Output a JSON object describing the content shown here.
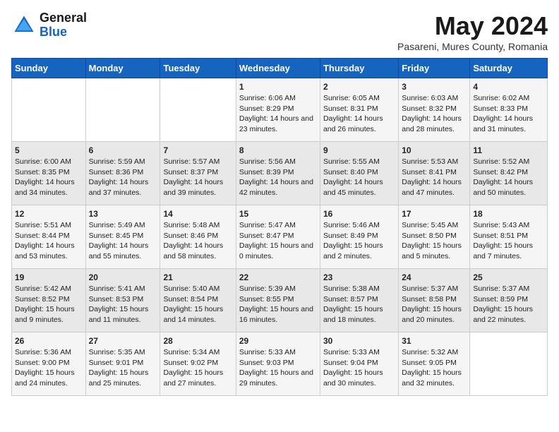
{
  "header": {
    "logo_general": "General",
    "logo_blue": "Blue",
    "month_title": "May 2024",
    "location": "Pasareni, Mures County, Romania"
  },
  "days_of_week": [
    "Sunday",
    "Monday",
    "Tuesday",
    "Wednesday",
    "Thursday",
    "Friday",
    "Saturday"
  ],
  "weeks": [
    [
      {
        "day": "",
        "sunrise": "",
        "sunset": "",
        "daylight": ""
      },
      {
        "day": "",
        "sunrise": "",
        "sunset": "",
        "daylight": ""
      },
      {
        "day": "",
        "sunrise": "",
        "sunset": "",
        "daylight": ""
      },
      {
        "day": "1",
        "sunrise": "Sunrise: 6:06 AM",
        "sunset": "Sunset: 8:29 PM",
        "daylight": "Daylight: 14 hours and 23 minutes."
      },
      {
        "day": "2",
        "sunrise": "Sunrise: 6:05 AM",
        "sunset": "Sunset: 8:31 PM",
        "daylight": "Daylight: 14 hours and 26 minutes."
      },
      {
        "day": "3",
        "sunrise": "Sunrise: 6:03 AM",
        "sunset": "Sunset: 8:32 PM",
        "daylight": "Daylight: 14 hours and 28 minutes."
      },
      {
        "day": "4",
        "sunrise": "Sunrise: 6:02 AM",
        "sunset": "Sunset: 8:33 PM",
        "daylight": "Daylight: 14 hours and 31 minutes."
      }
    ],
    [
      {
        "day": "5",
        "sunrise": "Sunrise: 6:00 AM",
        "sunset": "Sunset: 8:35 PM",
        "daylight": "Daylight: 14 hours and 34 minutes."
      },
      {
        "day": "6",
        "sunrise": "Sunrise: 5:59 AM",
        "sunset": "Sunset: 8:36 PM",
        "daylight": "Daylight: 14 hours and 37 minutes."
      },
      {
        "day": "7",
        "sunrise": "Sunrise: 5:57 AM",
        "sunset": "Sunset: 8:37 PM",
        "daylight": "Daylight: 14 hours and 39 minutes."
      },
      {
        "day": "8",
        "sunrise": "Sunrise: 5:56 AM",
        "sunset": "Sunset: 8:39 PM",
        "daylight": "Daylight: 14 hours and 42 minutes."
      },
      {
        "day": "9",
        "sunrise": "Sunrise: 5:55 AM",
        "sunset": "Sunset: 8:40 PM",
        "daylight": "Daylight: 14 hours and 45 minutes."
      },
      {
        "day": "10",
        "sunrise": "Sunrise: 5:53 AM",
        "sunset": "Sunset: 8:41 PM",
        "daylight": "Daylight: 14 hours and 47 minutes."
      },
      {
        "day": "11",
        "sunrise": "Sunrise: 5:52 AM",
        "sunset": "Sunset: 8:42 PM",
        "daylight": "Daylight: 14 hours and 50 minutes."
      }
    ],
    [
      {
        "day": "12",
        "sunrise": "Sunrise: 5:51 AM",
        "sunset": "Sunset: 8:44 PM",
        "daylight": "Daylight: 14 hours and 53 minutes."
      },
      {
        "day": "13",
        "sunrise": "Sunrise: 5:49 AM",
        "sunset": "Sunset: 8:45 PM",
        "daylight": "Daylight: 14 hours and 55 minutes."
      },
      {
        "day": "14",
        "sunrise": "Sunrise: 5:48 AM",
        "sunset": "Sunset: 8:46 PM",
        "daylight": "Daylight: 14 hours and 58 minutes."
      },
      {
        "day": "15",
        "sunrise": "Sunrise: 5:47 AM",
        "sunset": "Sunset: 8:47 PM",
        "daylight": "Daylight: 15 hours and 0 minutes."
      },
      {
        "day": "16",
        "sunrise": "Sunrise: 5:46 AM",
        "sunset": "Sunset: 8:49 PM",
        "daylight": "Daylight: 15 hours and 2 minutes."
      },
      {
        "day": "17",
        "sunrise": "Sunrise: 5:45 AM",
        "sunset": "Sunset: 8:50 PM",
        "daylight": "Daylight: 15 hours and 5 minutes."
      },
      {
        "day": "18",
        "sunrise": "Sunrise: 5:43 AM",
        "sunset": "Sunset: 8:51 PM",
        "daylight": "Daylight: 15 hours and 7 minutes."
      }
    ],
    [
      {
        "day": "19",
        "sunrise": "Sunrise: 5:42 AM",
        "sunset": "Sunset: 8:52 PM",
        "daylight": "Daylight: 15 hours and 9 minutes."
      },
      {
        "day": "20",
        "sunrise": "Sunrise: 5:41 AM",
        "sunset": "Sunset: 8:53 PM",
        "daylight": "Daylight: 15 hours and 11 minutes."
      },
      {
        "day": "21",
        "sunrise": "Sunrise: 5:40 AM",
        "sunset": "Sunset: 8:54 PM",
        "daylight": "Daylight: 15 hours and 14 minutes."
      },
      {
        "day": "22",
        "sunrise": "Sunrise: 5:39 AM",
        "sunset": "Sunset: 8:55 PM",
        "daylight": "Daylight: 15 hours and 16 minutes."
      },
      {
        "day": "23",
        "sunrise": "Sunrise: 5:38 AM",
        "sunset": "Sunset: 8:57 PM",
        "daylight": "Daylight: 15 hours and 18 minutes."
      },
      {
        "day": "24",
        "sunrise": "Sunrise: 5:37 AM",
        "sunset": "Sunset: 8:58 PM",
        "daylight": "Daylight: 15 hours and 20 minutes."
      },
      {
        "day": "25",
        "sunrise": "Sunrise: 5:37 AM",
        "sunset": "Sunset: 8:59 PM",
        "daylight": "Daylight: 15 hours and 22 minutes."
      }
    ],
    [
      {
        "day": "26",
        "sunrise": "Sunrise: 5:36 AM",
        "sunset": "Sunset: 9:00 PM",
        "daylight": "Daylight: 15 hours and 24 minutes."
      },
      {
        "day": "27",
        "sunrise": "Sunrise: 5:35 AM",
        "sunset": "Sunset: 9:01 PM",
        "daylight": "Daylight: 15 hours and 25 minutes."
      },
      {
        "day": "28",
        "sunrise": "Sunrise: 5:34 AM",
        "sunset": "Sunset: 9:02 PM",
        "daylight": "Daylight: 15 hours and 27 minutes."
      },
      {
        "day": "29",
        "sunrise": "Sunrise: 5:33 AM",
        "sunset": "Sunset: 9:03 PM",
        "daylight": "Daylight: 15 hours and 29 minutes."
      },
      {
        "day": "30",
        "sunrise": "Sunrise: 5:33 AM",
        "sunset": "Sunset: 9:04 PM",
        "daylight": "Daylight: 15 hours and 30 minutes."
      },
      {
        "day": "31",
        "sunrise": "Sunrise: 5:32 AM",
        "sunset": "Sunset: 9:05 PM",
        "daylight": "Daylight: 15 hours and 32 minutes."
      },
      {
        "day": "",
        "sunrise": "",
        "sunset": "",
        "daylight": ""
      }
    ]
  ]
}
